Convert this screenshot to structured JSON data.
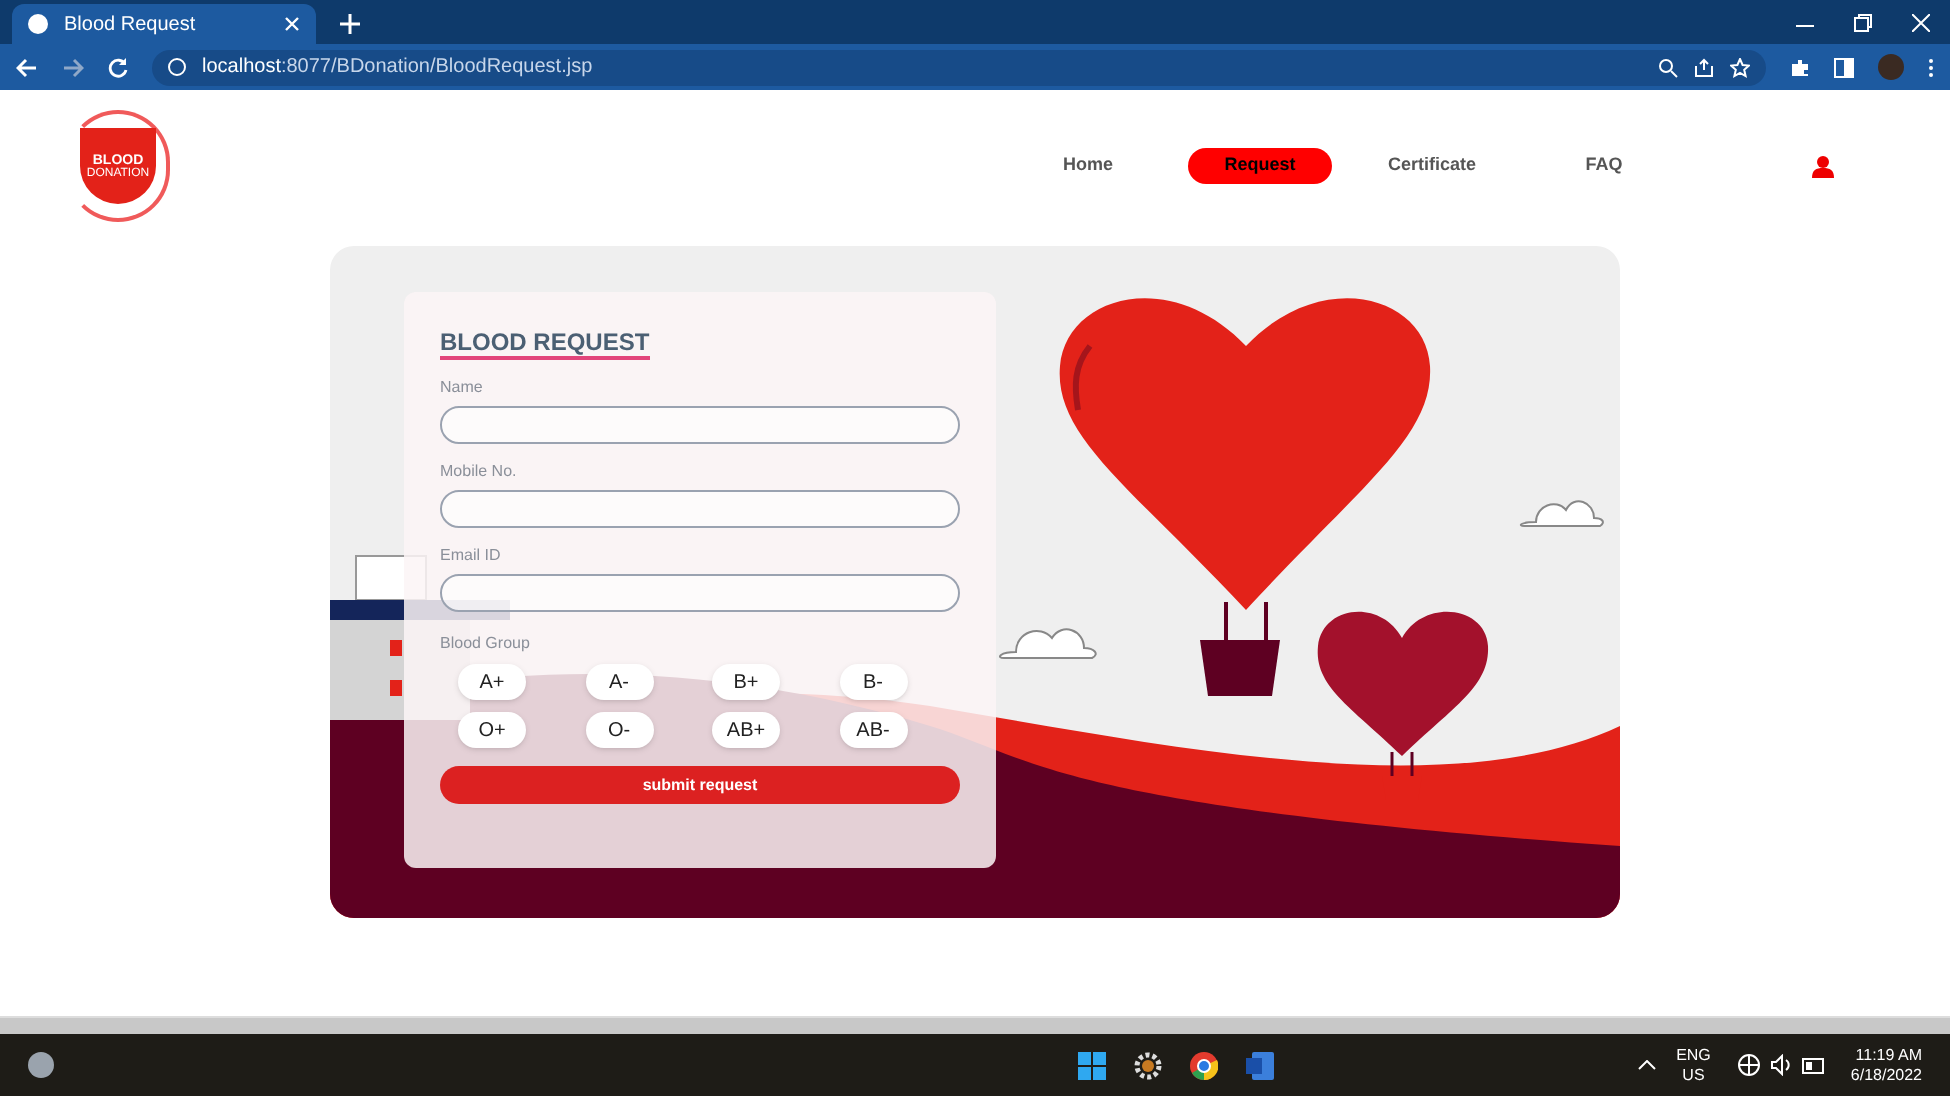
{
  "browser": {
    "tab_title": "Blood Request",
    "url_host": "localhost",
    "url_path": ":8077/BDonation/BloodRequest.jsp"
  },
  "logo": {
    "line1": "BLOOD",
    "line2": "DONATION"
  },
  "nav": [
    {
      "label": "Home",
      "selected": false
    },
    {
      "label": "Request",
      "selected": true
    },
    {
      "label": "Certificate",
      "selected": false
    },
    {
      "label": "FAQ",
      "selected": false
    }
  ],
  "form": {
    "title": "BLOOD REQUEST",
    "fields": [
      {
        "label": "Name"
      },
      {
        "label": "Mobile No."
      },
      {
        "label": "Email ID"
      }
    ],
    "group_label": "Blood Group",
    "groups": [
      "A+",
      "A-",
      "B+",
      "B-",
      "O+",
      "O-",
      "AB+",
      "AB-"
    ],
    "submit": "submit request"
  },
  "taskbar": {
    "lang": "ENG",
    "region": "US",
    "time": "11:19 AM",
    "date": "6/18/2022"
  }
}
